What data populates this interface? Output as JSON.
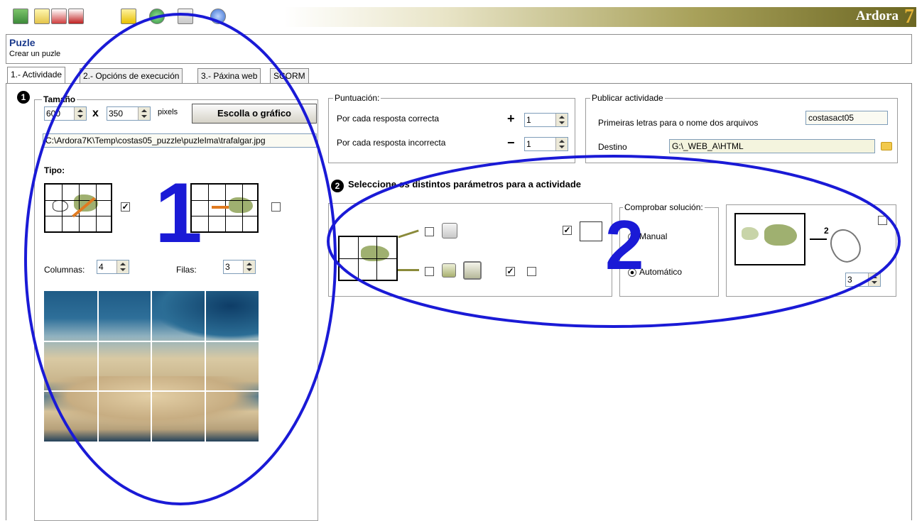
{
  "app": {
    "brand": "Ardora",
    "brand_version": "7"
  },
  "toolbar": {
    "icons": [
      "exit-icon",
      "new-document-icon",
      "save-as-icon",
      "save-icon",
      "folder-icon",
      "web-publish-icon",
      "package-icon",
      "help-icon"
    ]
  },
  "header": {
    "title": "Puzle",
    "subtitle": "Crear un puzle"
  },
  "tabs": [
    {
      "label": "1.- Actividade",
      "active": true
    },
    {
      "label": "2.- Opcións de execución",
      "active": false
    },
    {
      "label": "3.- Páxina web",
      "active": false
    },
    {
      "label": "SCORM",
      "active": false
    }
  ],
  "size": {
    "badge": "1",
    "legend": "Tamaño",
    "width": "600",
    "times": "x",
    "height": "350",
    "unit": "pixels",
    "choose_button": "Escolla o gráfico",
    "path": "C:\\Ardora7K\\Temp\\costas05_puzzle\\puzleIma\\trafalgar.jpg"
  },
  "tipo": {
    "label": "Tipo:",
    "option1_checked": "✓",
    "option2_checked": "",
    "columns_label": "Columnas:",
    "columns_value": "4",
    "rows_label": "Filas:",
    "rows_value": "3"
  },
  "score": {
    "legend": "Puntuación:",
    "correct_label": "Por cada resposta correcta",
    "correct_sign": "+",
    "correct_value": "1",
    "incorrect_label": "Por cada resposta incorrecta",
    "incorrect_sign": "−",
    "incorrect_value": "1"
  },
  "publish": {
    "legend": "Publicar actividade",
    "prefix_label": "Primeiras letras para o nome dos arquivos",
    "prefix_value": "costasact05",
    "dest_label": "Destino",
    "dest_value": "G:\\_WEB_A\\HTML"
  },
  "params": {
    "badge": "2",
    "title": "Seleccione os distintos parámetros para a actividade",
    "cb1": "",
    "cb2": "✓",
    "cb3": "",
    "cb4": "✓",
    "cb5": ""
  },
  "check": {
    "legend": "Comprobar solución:",
    "manual": "Manual",
    "auto": "Automático"
  },
  "attempts": {
    "value": "3",
    "arrow_label": "2"
  },
  "annotations": {
    "big1": "1",
    "big2": "2",
    "ellipse_color": "#1a1ad6",
    "number_color": "#1a1ad6"
  }
}
